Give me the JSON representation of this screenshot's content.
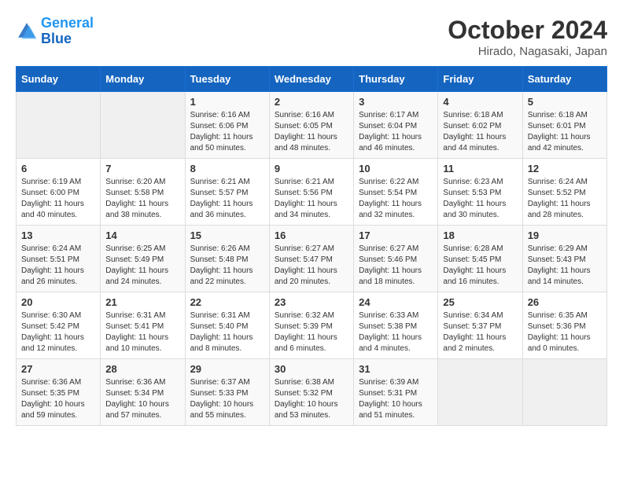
{
  "header": {
    "logo_line1": "General",
    "logo_line2": "Blue",
    "month": "October 2024",
    "location": "Hirado, Nagasaki, Japan"
  },
  "weekdays": [
    "Sunday",
    "Monday",
    "Tuesday",
    "Wednesday",
    "Thursday",
    "Friday",
    "Saturday"
  ],
  "weeks": [
    [
      {
        "day": "",
        "empty": true
      },
      {
        "day": "",
        "empty": true
      },
      {
        "day": "1",
        "sunrise": "6:16 AM",
        "sunset": "6:06 PM",
        "daylight": "11 hours and 50 minutes."
      },
      {
        "day": "2",
        "sunrise": "6:16 AM",
        "sunset": "6:05 PM",
        "daylight": "11 hours and 48 minutes."
      },
      {
        "day": "3",
        "sunrise": "6:17 AM",
        "sunset": "6:04 PM",
        "daylight": "11 hours and 46 minutes."
      },
      {
        "day": "4",
        "sunrise": "6:18 AM",
        "sunset": "6:02 PM",
        "daylight": "11 hours and 44 minutes."
      },
      {
        "day": "5",
        "sunrise": "6:18 AM",
        "sunset": "6:01 PM",
        "daylight": "11 hours and 42 minutes."
      }
    ],
    [
      {
        "day": "6",
        "sunrise": "6:19 AM",
        "sunset": "6:00 PM",
        "daylight": "11 hours and 40 minutes."
      },
      {
        "day": "7",
        "sunrise": "6:20 AM",
        "sunset": "5:58 PM",
        "daylight": "11 hours and 38 minutes."
      },
      {
        "day": "8",
        "sunrise": "6:21 AM",
        "sunset": "5:57 PM",
        "daylight": "11 hours and 36 minutes."
      },
      {
        "day": "9",
        "sunrise": "6:21 AM",
        "sunset": "5:56 PM",
        "daylight": "11 hours and 34 minutes."
      },
      {
        "day": "10",
        "sunrise": "6:22 AM",
        "sunset": "5:54 PM",
        "daylight": "11 hours and 32 minutes."
      },
      {
        "day": "11",
        "sunrise": "6:23 AM",
        "sunset": "5:53 PM",
        "daylight": "11 hours and 30 minutes."
      },
      {
        "day": "12",
        "sunrise": "6:24 AM",
        "sunset": "5:52 PM",
        "daylight": "11 hours and 28 minutes."
      }
    ],
    [
      {
        "day": "13",
        "sunrise": "6:24 AM",
        "sunset": "5:51 PM",
        "daylight": "11 hours and 26 minutes."
      },
      {
        "day": "14",
        "sunrise": "6:25 AM",
        "sunset": "5:49 PM",
        "daylight": "11 hours and 24 minutes."
      },
      {
        "day": "15",
        "sunrise": "6:26 AM",
        "sunset": "5:48 PM",
        "daylight": "11 hours and 22 minutes."
      },
      {
        "day": "16",
        "sunrise": "6:27 AM",
        "sunset": "5:47 PM",
        "daylight": "11 hours and 20 minutes."
      },
      {
        "day": "17",
        "sunrise": "6:27 AM",
        "sunset": "5:46 PM",
        "daylight": "11 hours and 18 minutes."
      },
      {
        "day": "18",
        "sunrise": "6:28 AM",
        "sunset": "5:45 PM",
        "daylight": "11 hours and 16 minutes."
      },
      {
        "day": "19",
        "sunrise": "6:29 AM",
        "sunset": "5:43 PM",
        "daylight": "11 hours and 14 minutes."
      }
    ],
    [
      {
        "day": "20",
        "sunrise": "6:30 AM",
        "sunset": "5:42 PM",
        "daylight": "11 hours and 12 minutes."
      },
      {
        "day": "21",
        "sunrise": "6:31 AM",
        "sunset": "5:41 PM",
        "daylight": "11 hours and 10 minutes."
      },
      {
        "day": "22",
        "sunrise": "6:31 AM",
        "sunset": "5:40 PM",
        "daylight": "11 hours and 8 minutes."
      },
      {
        "day": "23",
        "sunrise": "6:32 AM",
        "sunset": "5:39 PM",
        "daylight": "11 hours and 6 minutes."
      },
      {
        "day": "24",
        "sunrise": "6:33 AM",
        "sunset": "5:38 PM",
        "daylight": "11 hours and 4 minutes."
      },
      {
        "day": "25",
        "sunrise": "6:34 AM",
        "sunset": "5:37 PM",
        "daylight": "11 hours and 2 minutes."
      },
      {
        "day": "26",
        "sunrise": "6:35 AM",
        "sunset": "5:36 PM",
        "daylight": "11 hours and 0 minutes."
      }
    ],
    [
      {
        "day": "27",
        "sunrise": "6:36 AM",
        "sunset": "5:35 PM",
        "daylight": "10 hours and 59 minutes."
      },
      {
        "day": "28",
        "sunrise": "6:36 AM",
        "sunset": "5:34 PM",
        "daylight": "10 hours and 57 minutes."
      },
      {
        "day": "29",
        "sunrise": "6:37 AM",
        "sunset": "5:33 PM",
        "daylight": "10 hours and 55 minutes."
      },
      {
        "day": "30",
        "sunrise": "6:38 AM",
        "sunset": "5:32 PM",
        "daylight": "10 hours and 53 minutes."
      },
      {
        "day": "31",
        "sunrise": "6:39 AM",
        "sunset": "5:31 PM",
        "daylight": "10 hours and 51 minutes."
      },
      {
        "day": "",
        "empty": true
      },
      {
        "day": "",
        "empty": true
      }
    ]
  ]
}
